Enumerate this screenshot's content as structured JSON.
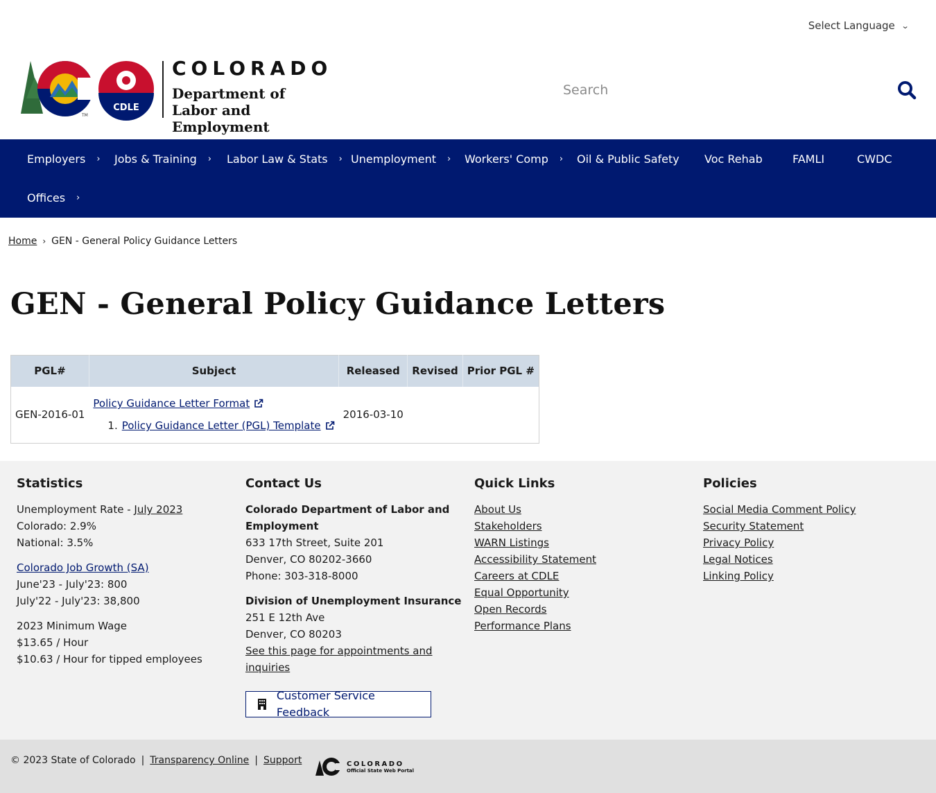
{
  "language": {
    "label": "Select Language"
  },
  "logo": {
    "state": "COLORADO",
    "dept_line1": "Department of",
    "dept_line2": "Labor and Employment",
    "badge": "CDLE",
    "tm": "TM"
  },
  "search": {
    "placeholder": "Search"
  },
  "nav": {
    "items": [
      {
        "label": "Employers"
      },
      {
        "label": "Jobs & Training"
      },
      {
        "label": "Labor Law & Stats"
      },
      {
        "label": "Unemployment"
      },
      {
        "label": "Workers' Comp"
      },
      {
        "label": "Oil & Public Safety"
      },
      {
        "label": "Voc Rehab"
      },
      {
        "label": "FAMLI"
      },
      {
        "label": "CWDC"
      },
      {
        "label": "Offices"
      }
    ]
  },
  "breadcrumb": {
    "home": "Home",
    "current": "GEN - General Policy Guidance Letters"
  },
  "page": {
    "title": "GEN - General Policy Guidance Letters"
  },
  "table": {
    "headers": [
      "PGL#",
      "Subject",
      "Released",
      "Revised",
      "Prior PGL #"
    ],
    "rows": [
      {
        "pgl": "GEN-2016-01",
        "subject_link": "Policy Guidance Letter Format",
        "sub_item_num": "1.",
        "sub_item_link": "Policy Guidance Letter (PGL) Template",
        "released": "2016-03-10",
        "revised": "",
        "prior": ""
      }
    ]
  },
  "footer": {
    "statistics": {
      "heading": "Statistics",
      "unemp_prefix": "Unemployment Rate - ",
      "unemp_link": "July 2023",
      "colorado": "Colorado: 2.9%",
      "national": "National: 3.5%",
      "job_growth_link": "Colorado Job Growth (SA)",
      "growth1": "June'23 - July'23: 800",
      "growth2": "July'22 - July'23: 38,800",
      "min_wage_title": "2023 Minimum Wage",
      "min_wage": "$13.65 / Hour",
      "tipped": "$10.63 / Hour for tipped employees"
    },
    "contact": {
      "heading": "Contact Us",
      "org_line1": "Colorado Department of Labor and",
      "org_line2": "Employment",
      "addr1": "633 17th Street, Suite 201",
      "addr2": "Denver, CO  80202-3660",
      "phone": "Phone: 303-318-8000",
      "div": "Division of Unemployment Insurance",
      "div_addr1": "251 E 12th Ave",
      "div_addr2": "Denver, CO  80203",
      "appt_line1": "See this page for appointments and",
      "appt_line2": "inquiries",
      "feedback": "Customer Service Feedback"
    },
    "quick_links": {
      "heading": "Quick Links",
      "items": [
        "About Us",
        "Stakeholders",
        "WARN Listings",
        "Accessibility Statement",
        "Careers at CDLE",
        "Equal Opportunity",
        "Open Records",
        "Performance Plans"
      ]
    },
    "policies": {
      "heading": "Policies",
      "items": [
        "Social Media Comment Policy",
        "Security Statement",
        "Privacy Policy",
        "Legal Notices",
        "Linking Policy"
      ]
    }
  },
  "bottom": {
    "copyright": "© 2023 State of Colorado",
    "sep": "|",
    "transparency": "Transparency Online",
    "support": "Support",
    "portal_title": "COLORADO",
    "portal_sub": "Official State Web Portal"
  },
  "colors": {
    "nav_bg": "#001970",
    "table_header": "#cfdae6",
    "footer_bg": "#f2f2f2",
    "bottom_bg": "#e0e0e0",
    "brand_red": "#c8102e",
    "brand_gold": "#f2b705",
    "brand_green": "#2f6b3a"
  }
}
